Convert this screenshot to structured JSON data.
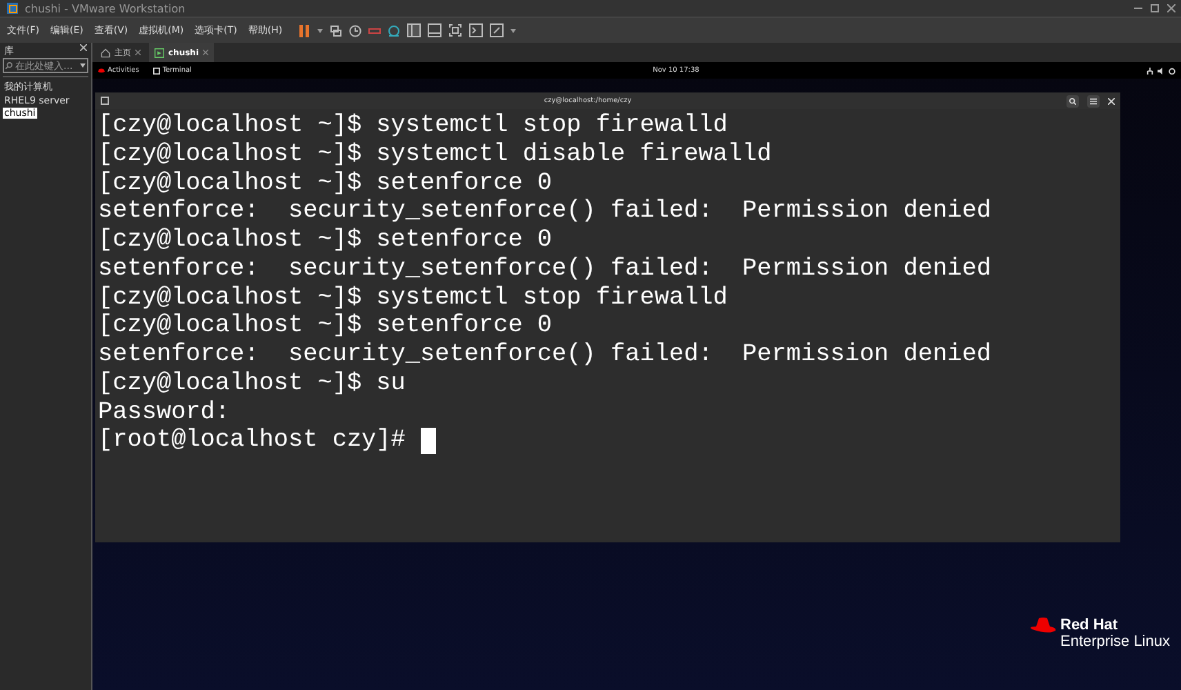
{
  "window": {
    "title": "chushi - VMware Workstation"
  },
  "menu": [
    "文件(F)",
    "编辑(E)",
    "查看(V)",
    "虚拟机(M)",
    "选项卡(T)",
    "帮助(H)"
  ],
  "library": {
    "title": "库",
    "search": {
      "placeholder": "在此处键入..."
    },
    "tree": [
      {
        "label": "我的计算机",
        "selected": false,
        "children": [
          {
            "label": "RHEL9 server",
            "selected": false
          },
          {
            "label": "chushi",
            "selected": true
          }
        ]
      }
    ]
  },
  "tabs": [
    {
      "label": "主页",
      "kind": "home",
      "selected": false
    },
    {
      "label": "chushi",
      "kind": "vm",
      "selected": true
    }
  ],
  "guest": {
    "top_bar": {
      "activities": "Activities",
      "app": "Terminal",
      "clock": "Nov 10  17:38"
    },
    "terminal": {
      "title": "czy@localhost:/home/czy",
      "lines": [
        "[czy@localhost ~]$ systemctl stop firewalld",
        "[czy@localhost ~]$ systemctl disable firewalld",
        "[czy@localhost ~]$ setenforce 0",
        "setenforce:  security_setenforce() failed:  Permission denied",
        "[czy@localhost ~]$ setenforce 0",
        "setenforce:  security_setenforce() failed:  Permission denied",
        "[czy@localhost ~]$ systemctl stop firewalld",
        "[czy@localhost ~]$ setenforce 0",
        "setenforce:  security_setenforce() failed:  Permission denied",
        "[czy@localhost ~]$ su",
        "Password:",
        "[root@localhost czy]# "
      ]
    },
    "branding": {
      "line_1": "Red Hat",
      "line_2": "Enterprise Linux"
    }
  }
}
